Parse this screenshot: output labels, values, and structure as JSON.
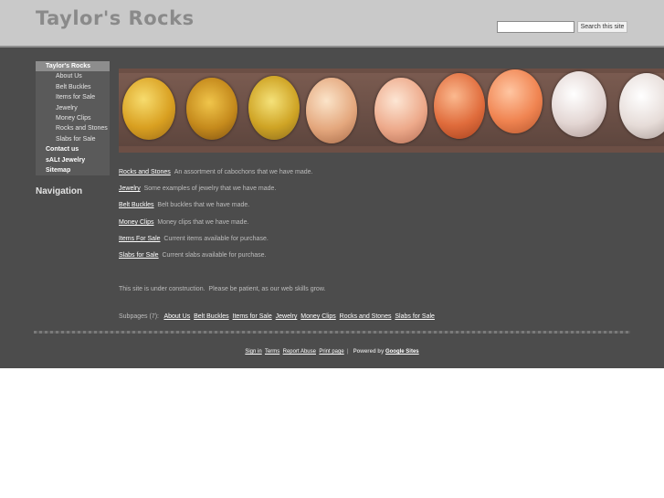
{
  "header": {
    "site_title": "Taylor's Rocks",
    "search": {
      "value": "",
      "placeholder": "",
      "button_label": "Search this site"
    }
  },
  "sidebar": {
    "items": [
      {
        "label": "Taylor's Rocks",
        "level": 1,
        "current": true
      },
      {
        "label": "About Us",
        "level": 2
      },
      {
        "label": "Belt Buckles",
        "level": 2
      },
      {
        "label": "Items for Sale",
        "level": 2
      },
      {
        "label": "Jewelry",
        "level": 2
      },
      {
        "label": "Money Clips",
        "level": 2
      },
      {
        "label": "Rocks and Stones",
        "level": 2
      },
      {
        "label": "Slabs for Sale",
        "level": 2
      },
      {
        "label": "Contact us",
        "level": 1
      },
      {
        "label": "sALt Jewelry",
        "level": 1
      },
      {
        "label": "Sitemap",
        "level": 1
      }
    ],
    "nav_heading": "Navigation"
  },
  "main": {
    "banner_alt": "",
    "entries": [
      {
        "link": "Rocks and Stones",
        "text": "An assortment of cabochons that we have made."
      },
      {
        "link": "Jewelry",
        "text": "Some examples of jewelry that we have made."
      },
      {
        "link": "Belt Buckles",
        "text": "Belt buckles that we have made."
      },
      {
        "link": "Money Clips",
        "text": "Money clips that we have made."
      },
      {
        "link": "Items For Sale",
        "text": "Current items available for purchase."
      },
      {
        "link": "Slabs for Sale",
        "text": "Current slabs available for purchase."
      }
    ],
    "construction_note": "This site is under construction.  Please be patient, as our web skills grow.",
    "subpages_label": "Subpages (7):",
    "subpages": [
      "About Us",
      "Belt Buckles",
      "Items for Sale",
      "Jewelry",
      "Money Clips",
      "Rocks and Stones",
      "Slabs for Sale"
    ]
  },
  "footer": {
    "links": [
      "Sign in",
      "Terms",
      "Report Abuse",
      "Print page"
    ],
    "separator": "|",
    "powered_prefix": "Powered by",
    "powered_link": "Google Sites"
  },
  "colors": {
    "header_bg": "#c9c9c9",
    "content_bg": "#4c4c4c",
    "title_color": "#8a8a8a"
  }
}
